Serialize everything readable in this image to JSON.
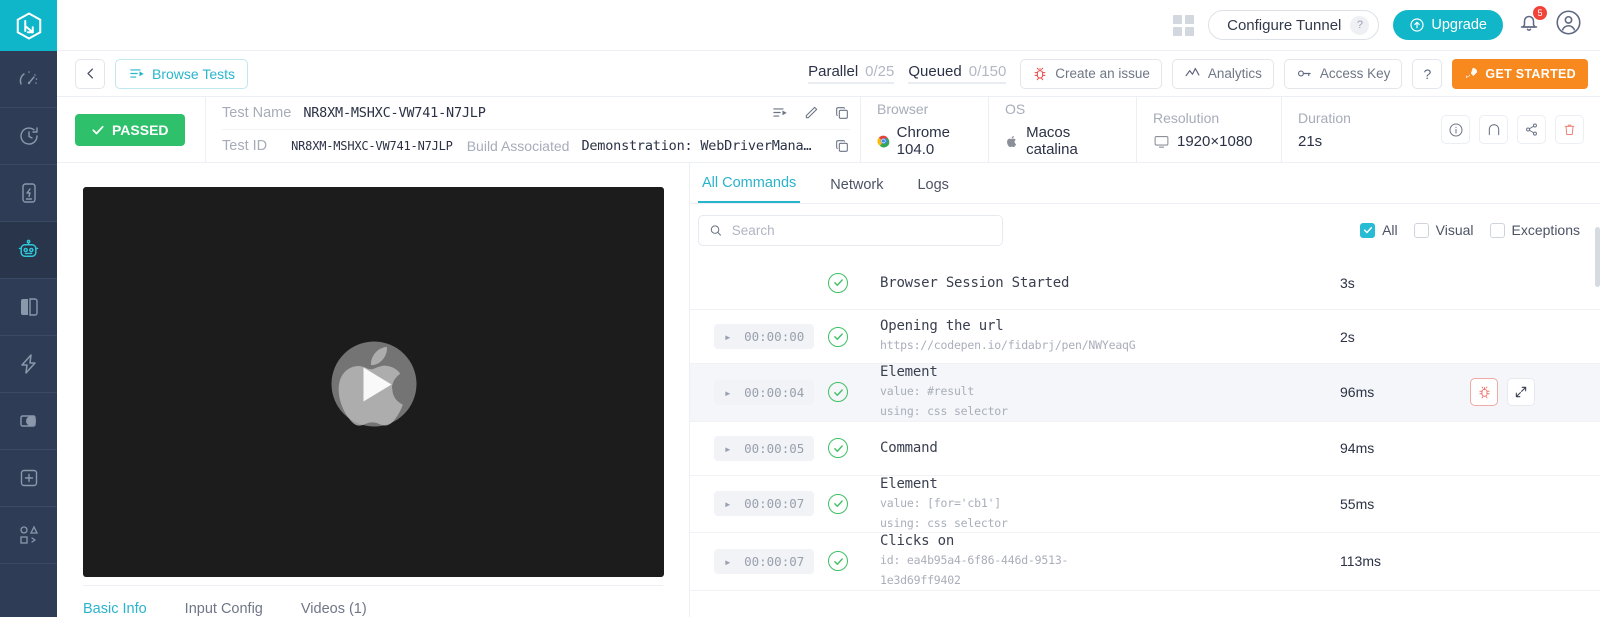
{
  "brand": {
    "accent": "#11b7c8",
    "rail_bg": "#2e3d55",
    "orange": "#f7891f",
    "green": "#2ec06a"
  },
  "header": {
    "grid_icon": "grid-apps-icon",
    "configure_tunnel": "Configure Tunnel",
    "configure_tunnel_help": "?",
    "upgrade": "Upgrade",
    "upgrade_icon": "arrow-up-circle-icon",
    "bell_icon": "notification-bell-icon",
    "notification_count": "5",
    "avatar_icon": "user-avatar-icon"
  },
  "toolbar": {
    "back_icon": "chevron-left-icon",
    "browse_tests": "Browse Tests",
    "browse_icon": "list-play-icon",
    "parallel_label": "Parallel",
    "parallel_value": "0/25",
    "queued_label": "Queued",
    "queued_value": "0/150",
    "create_issue": "Create an issue",
    "create_issue_icon": "bug-icon",
    "analytics": "Analytics",
    "analytics_icon": "line-chart-icon",
    "access_key": "Access Key",
    "access_key_icon": "key-icon",
    "help": "?",
    "get_started": "GET STARTED",
    "get_started_icon": "rocket-icon"
  },
  "testinfo": {
    "status": "PASSED",
    "status_icon": "check-icon",
    "test_name_label": "Test Name",
    "test_name_value": "NR8XM-MSHXC-VW741-N7JLP",
    "test_id_label": "Test ID",
    "test_id_value": "NR8XM-MSHXC-VW741-N7JLP",
    "build_label": "Build Associated",
    "build_value": "Demonstration: WebDriverMana…",
    "name_row_icons": [
      "list-play-icon",
      "edit-pencil-icon",
      "copy-icon"
    ],
    "id_row_icon": "copy-icon",
    "specs": [
      {
        "label": "Browser",
        "value": "Chrome 104.0",
        "icon": "chrome-icon"
      },
      {
        "label": "OS",
        "value": "Macos catalina",
        "icon": "apple-icon"
      },
      {
        "label": "Resolution",
        "value": "1920×1080",
        "icon": "monitor-icon"
      },
      {
        "label": "Duration",
        "value": "21s",
        "icon": ""
      }
    ],
    "actions": [
      "info-icon",
      "intersect-icon",
      "share-icon",
      "delete-icon"
    ]
  },
  "video": {
    "poster_icon": "apple-logo",
    "play_icon": "play-icon",
    "tabs": [
      {
        "label": "Basic Info",
        "active": true
      },
      {
        "label": "Input Config",
        "active": false
      },
      {
        "label": "Videos (1)",
        "active": false
      }
    ]
  },
  "commands_panel": {
    "tabs": [
      {
        "label": "All Commands",
        "active": true
      },
      {
        "label": "Network",
        "active": false
      },
      {
        "label": "Logs",
        "active": false
      }
    ],
    "search": {
      "placeholder": "Search",
      "value": "",
      "icon": "search-icon"
    },
    "filters": [
      {
        "label": "All",
        "checked": true
      },
      {
        "label": "Visual",
        "checked": false
      },
      {
        "label": "Exceptions",
        "checked": false
      }
    ],
    "rows": [
      {
        "timestamp": "",
        "status_icon": "check-circle-icon",
        "title": "Browser Session Started",
        "sub1": "",
        "sub2": "",
        "duration": "3s",
        "selected": false,
        "actions": []
      },
      {
        "timestamp": "00:00:00",
        "status_icon": "check-circle-icon",
        "title": "Opening the url",
        "sub1": "https://codepen.io/fidabrj/pen/NWYeaqG",
        "sub2": "",
        "duration": "2s",
        "selected": false,
        "actions": []
      },
      {
        "timestamp": "00:00:04",
        "status_icon": "check-circle-icon",
        "title": "Element",
        "sub1": "value: #result",
        "sub2": "using: css selector",
        "duration": "96ms",
        "selected": true,
        "actions": [
          "bug-icon",
          "expand-icon"
        ]
      },
      {
        "timestamp": "00:00:05",
        "status_icon": "check-circle-icon",
        "title": "Command",
        "sub1": "",
        "sub2": "",
        "duration": "94ms",
        "selected": false,
        "actions": []
      },
      {
        "timestamp": "00:00:07",
        "status_icon": "check-circle-icon",
        "title": "Element",
        "sub1": "value: [for='cb1']",
        "sub2": "using: css selector",
        "duration": "55ms",
        "selected": false,
        "actions": []
      },
      {
        "timestamp": "00:00:07",
        "status_icon": "check-circle-icon",
        "title": "Clicks on",
        "sub1": "id: ea4b95a4-6f86-446d-9513-",
        "sub2": "1e3d69ff9402",
        "duration": "113ms",
        "selected": false,
        "actions": []
      }
    ]
  },
  "rail": {
    "logo_icon": "lambdatest-logo",
    "items": [
      {
        "icon": "speedometer-icon",
        "active": false
      },
      {
        "icon": "clock-history-icon",
        "active": false
      },
      {
        "icon": "device-lightning-icon",
        "active": false
      },
      {
        "icon": "robot-icon",
        "active": true
      },
      {
        "icon": "split-screen-icon",
        "active": false
      },
      {
        "icon": "lightning-bolt-icon",
        "active": false
      },
      {
        "icon": "contrast-circle-icon",
        "active": false
      },
      {
        "icon": "plus-square-icon",
        "active": false
      },
      {
        "icon": "shapes-code-icon",
        "active": false
      }
    ]
  }
}
